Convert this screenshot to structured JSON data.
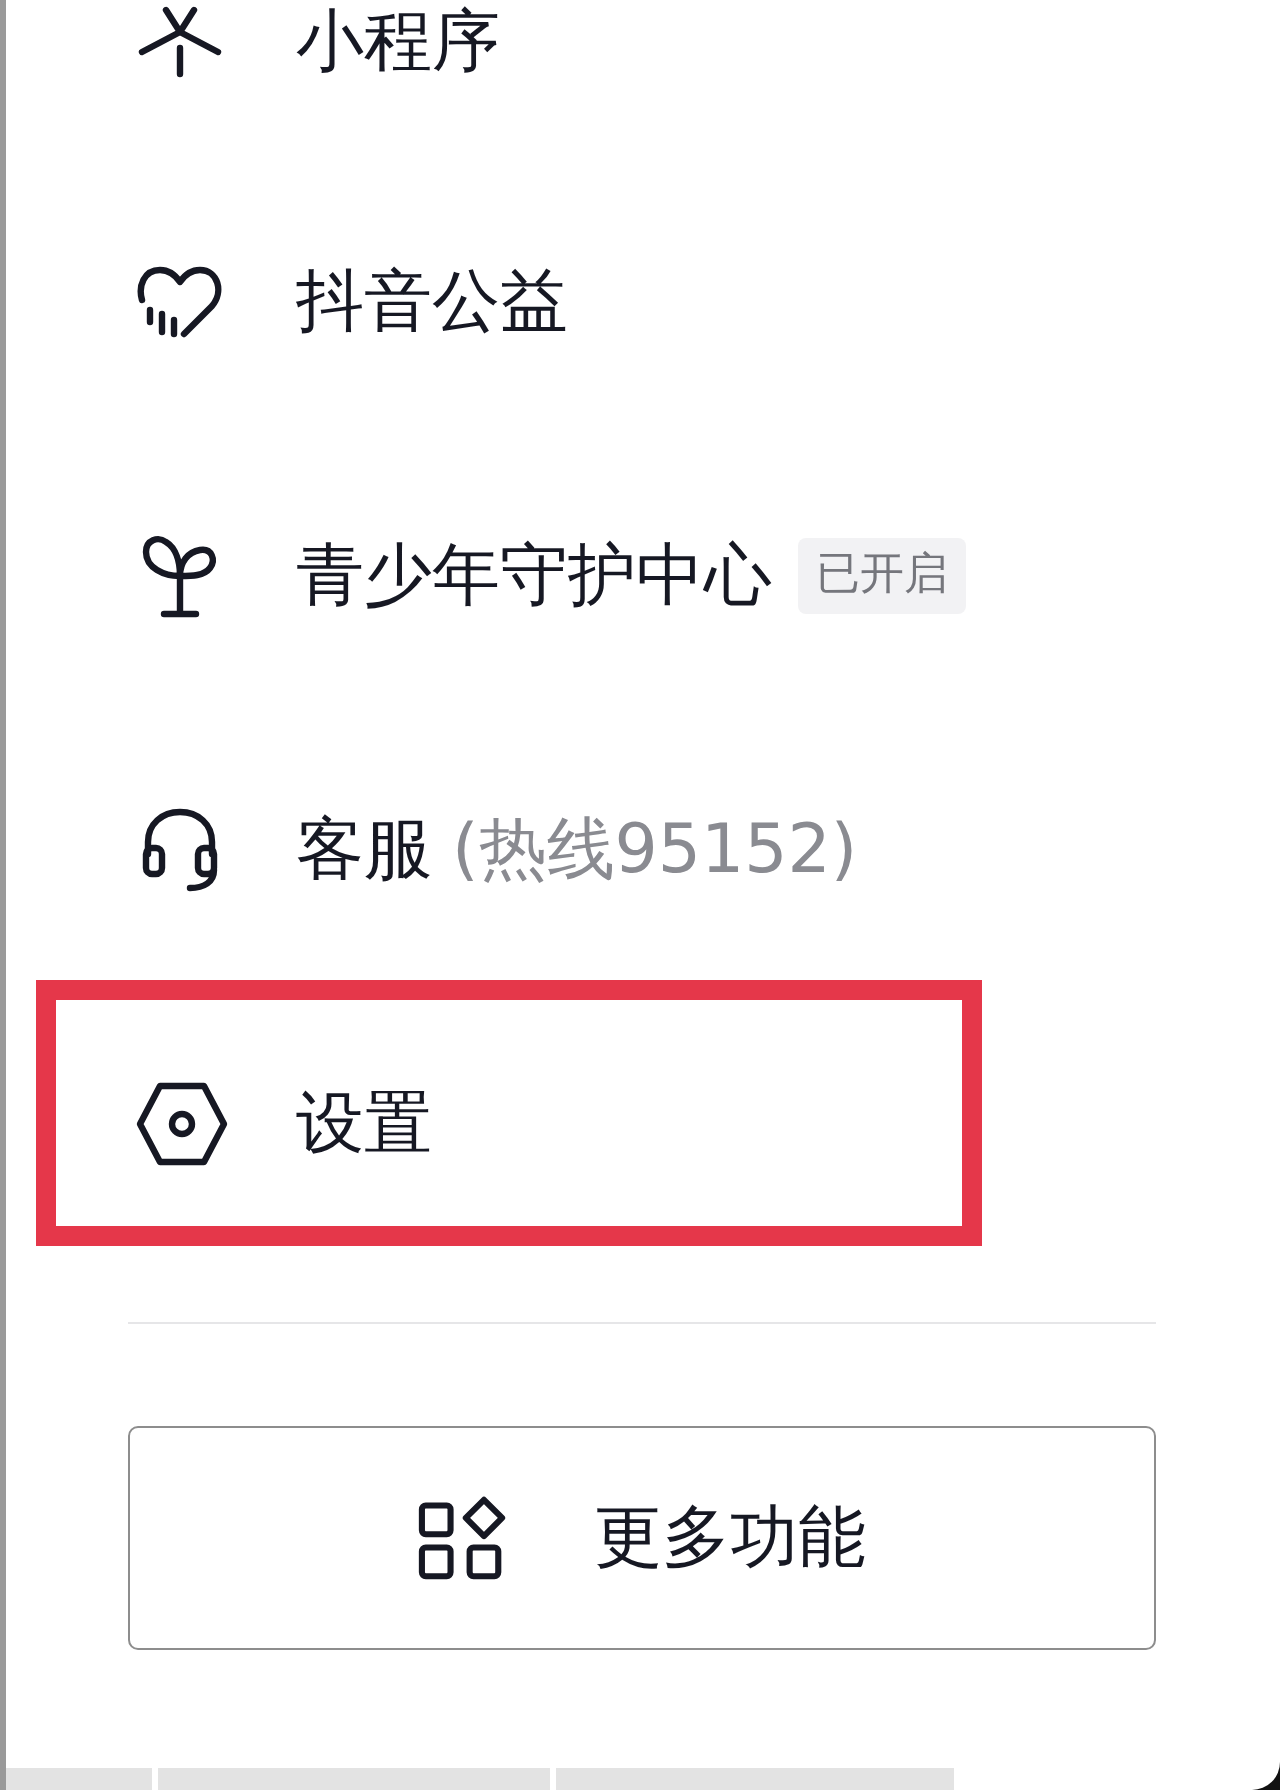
{
  "menu": {
    "items": [
      {
        "label": "小程序",
        "highlighted": false
      },
      {
        "label": "抖音公益",
        "highlighted": false
      },
      {
        "label": "青少年守护中心",
        "badge": "已开启",
        "highlighted": false
      },
      {
        "label": "客服",
        "note": "(热线95152)",
        "highlighted": false
      },
      {
        "label": "设置",
        "highlighted": true
      }
    ]
  },
  "more_button": {
    "label": "更多功能"
  }
}
